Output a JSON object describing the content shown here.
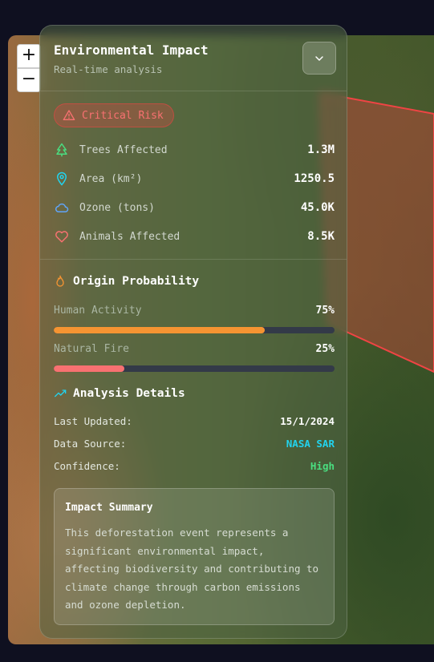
{
  "map": {
    "zoom_in_label": "+",
    "zoom_out_label": "−",
    "region_color": "#ef4444"
  },
  "panel": {
    "title": "Environmental Impact",
    "subtitle": "Real-time analysis",
    "collapse_icon": "chevron-down-icon",
    "risk_badge": {
      "label": "Critical Risk",
      "icon": "warning-triangle-icon",
      "color": "#f87171"
    },
    "stats": [
      {
        "label": "Trees Affected",
        "value": "1.3M",
        "icon": "tree-icon",
        "color": "#4ade80"
      },
      {
        "label": "Area (km²)",
        "value": "1250.5",
        "icon": "map-pin-icon",
        "color": "#22d3ee"
      },
      {
        "label": "Ozone (tons)",
        "value": "45.0K",
        "icon": "cloud-icon",
        "color": "#60a5fa"
      },
      {
        "label": "Animals Affected",
        "value": "8.5K",
        "icon": "heart-icon",
        "color": "#f87171"
      }
    ],
    "origin": {
      "title": "Origin Probability",
      "icon": "flame-icon",
      "items": [
        {
          "name": "Human Activity",
          "percent_label": "75%",
          "percent": 75,
          "color": "#f59432"
        },
        {
          "name": "Natural Fire",
          "percent_label": "25%",
          "percent": 25,
          "color": "#f87171"
        }
      ]
    },
    "analysis": {
      "title": "Analysis Details",
      "icon": "trending-up-icon",
      "rows": [
        {
          "key": "Last Updated:",
          "value": "15/1/2024",
          "color": "#ffffff"
        },
        {
          "key": "Data Source:",
          "value": "NASA SAR",
          "color": "#22d3ee"
        },
        {
          "key": "Confidence:",
          "value": "High",
          "color": "#4ade80"
        }
      ]
    },
    "summary": {
      "title": "Impact Summary",
      "text": "This deforestation event represents a significant environmental impact, affecting biodiversity and contributing to climate change through carbon emissions and ozone depletion."
    }
  }
}
